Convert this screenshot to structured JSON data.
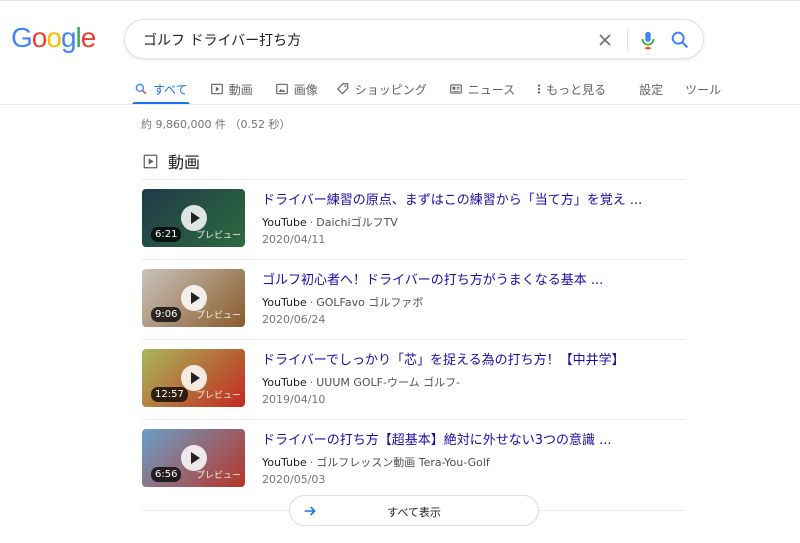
{
  "logo": {
    "letters": [
      "G",
      "o",
      "o",
      "g",
      "l",
      "e"
    ],
    "colors": [
      "#4285f4",
      "#ea4335",
      "#fbbc05",
      "#4285f4",
      "#34a853",
      "#ea4335"
    ]
  },
  "search": {
    "query": "ゴルフ ドライバー打ち方",
    "icons": {
      "clear": "close-icon",
      "voice": "mic-icon",
      "submit": "search-icon"
    }
  },
  "tabs": [
    {
      "label": "すべて",
      "icon": "search-icon",
      "active": true
    },
    {
      "label": "動画",
      "icon": "video-icon"
    },
    {
      "label": "画像",
      "icon": "image-icon"
    },
    {
      "label": "ショッピング",
      "icon": "tag-icon"
    },
    {
      "label": "ニュース",
      "icon": "news-icon"
    },
    {
      "label": "もっと見る",
      "icon": "more-vert-icon"
    },
    {
      "label": "設定"
    },
    {
      "label": "ツール"
    }
  ],
  "result_stats": "約 9,860,000 件 （0.52 秒）",
  "videos_section": {
    "title": "動画",
    "items": [
      {
        "title": "ドライバー練習の原点、まずはこの練習から「当て方」を覚え ...",
        "platform": "YouTube",
        "channel": "DaichiゴルフTV",
        "date": "2020/04/11",
        "duration": "6:21",
        "preview_label": "プレビュー",
        "thumb_colors": [
          "#1f3a4a",
          "#2d6a3e"
        ]
      },
      {
        "title": "ゴルフ初心者へ！ドライバーの打ち方がうまくなる基本 ...",
        "platform": "YouTube",
        "channel": "GOLFavo ゴルファボ",
        "date": "2020/06/24",
        "duration": "9:06",
        "preview_label": "プレビュー",
        "thumb_colors": [
          "#c9c4bd",
          "#8a5a2a"
        ]
      },
      {
        "title": "ドライバーでしっかり「芯」を捉える為の打ち方！【中井学】",
        "platform": "YouTube",
        "channel": "UUUM GOLF-ウーム ゴルフ-",
        "date": "2019/04/10",
        "duration": "12:57",
        "preview_label": "プレビュー",
        "thumb_colors": [
          "#a8b85a",
          "#c22a1e"
        ]
      },
      {
        "title": "ドライバーの打ち方【超基本】絶対に外せない3つの意識 ...",
        "platform": "YouTube",
        "channel": "ゴルフレッスン動画 Tera-You-Golf",
        "date": "2020/05/03",
        "duration": "6:56",
        "preview_label": "プレビュー",
        "thumb_colors": [
          "#6aa0c8",
          "#b8342a"
        ]
      }
    ],
    "show_all_label": "すべて表示"
  }
}
